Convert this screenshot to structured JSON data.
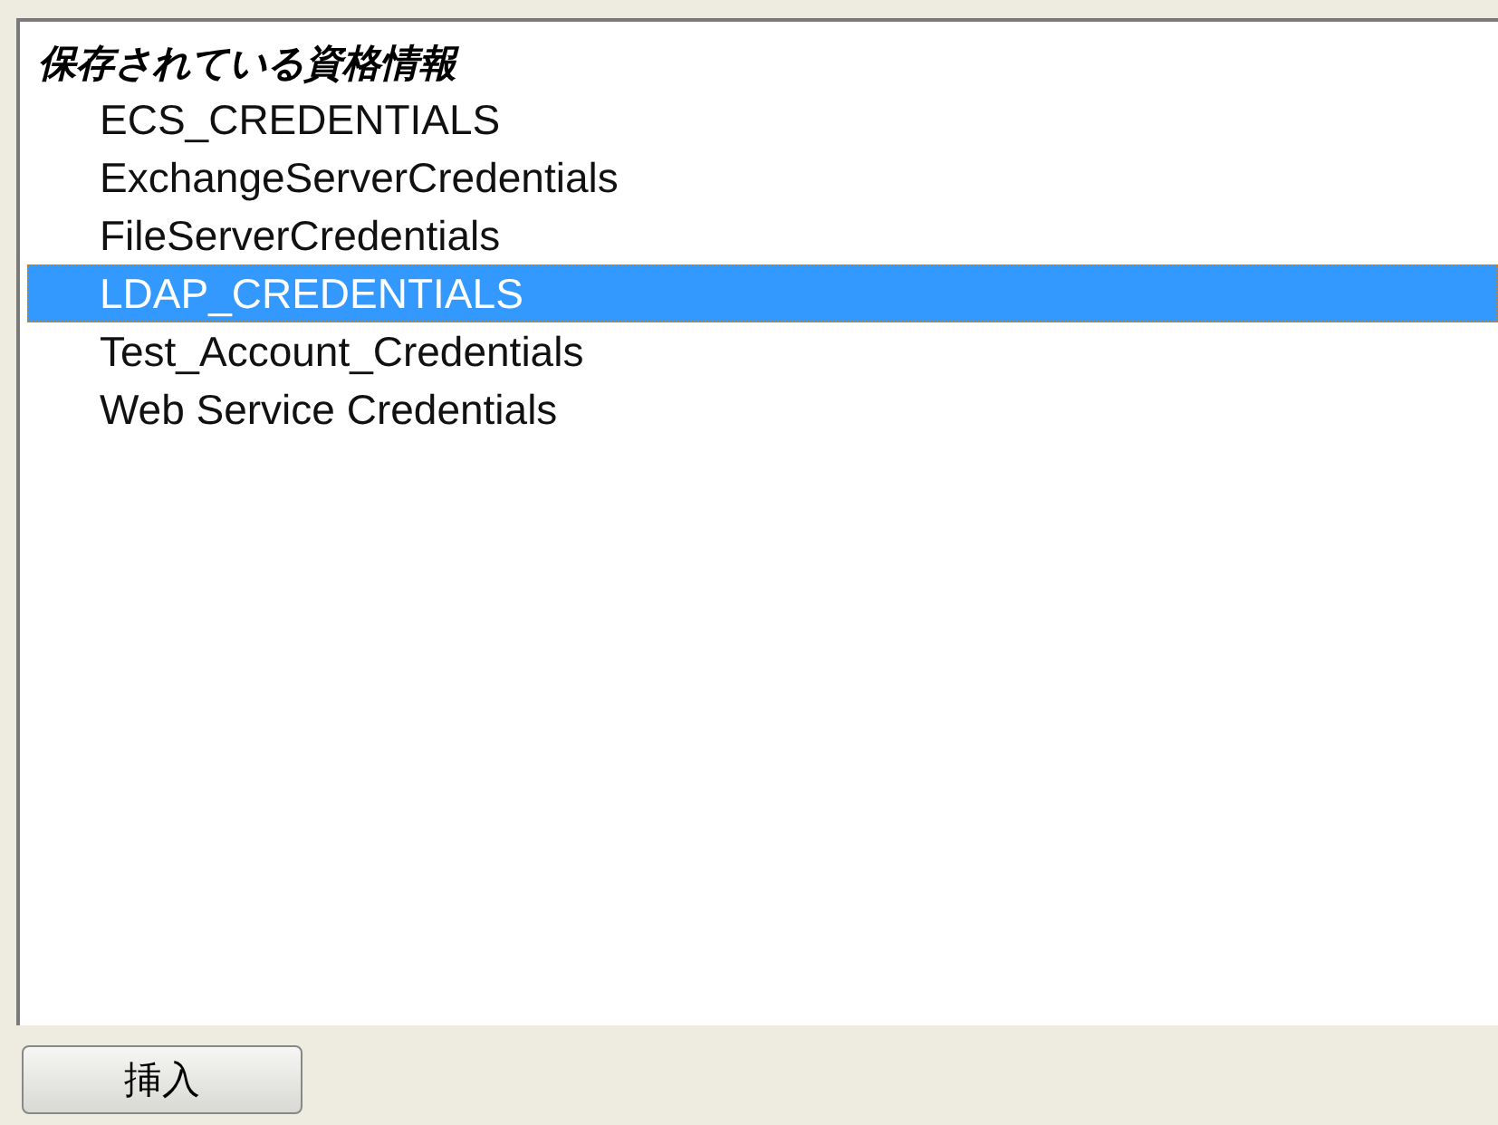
{
  "list": {
    "heading": "保存されている資格情報",
    "items": [
      {
        "label": "ECS_CREDENTIALS",
        "selected": false
      },
      {
        "label": "ExchangeServerCredentials",
        "selected": false
      },
      {
        "label": "FileServerCredentials",
        "selected": false
      },
      {
        "label": "LDAP_CREDENTIALS",
        "selected": true
      },
      {
        "label": "Test_Account_Credentials",
        "selected": false
      },
      {
        "label": "Web Service Credentials",
        "selected": false
      }
    ]
  },
  "buttons": [
    "挿入"
  ]
}
